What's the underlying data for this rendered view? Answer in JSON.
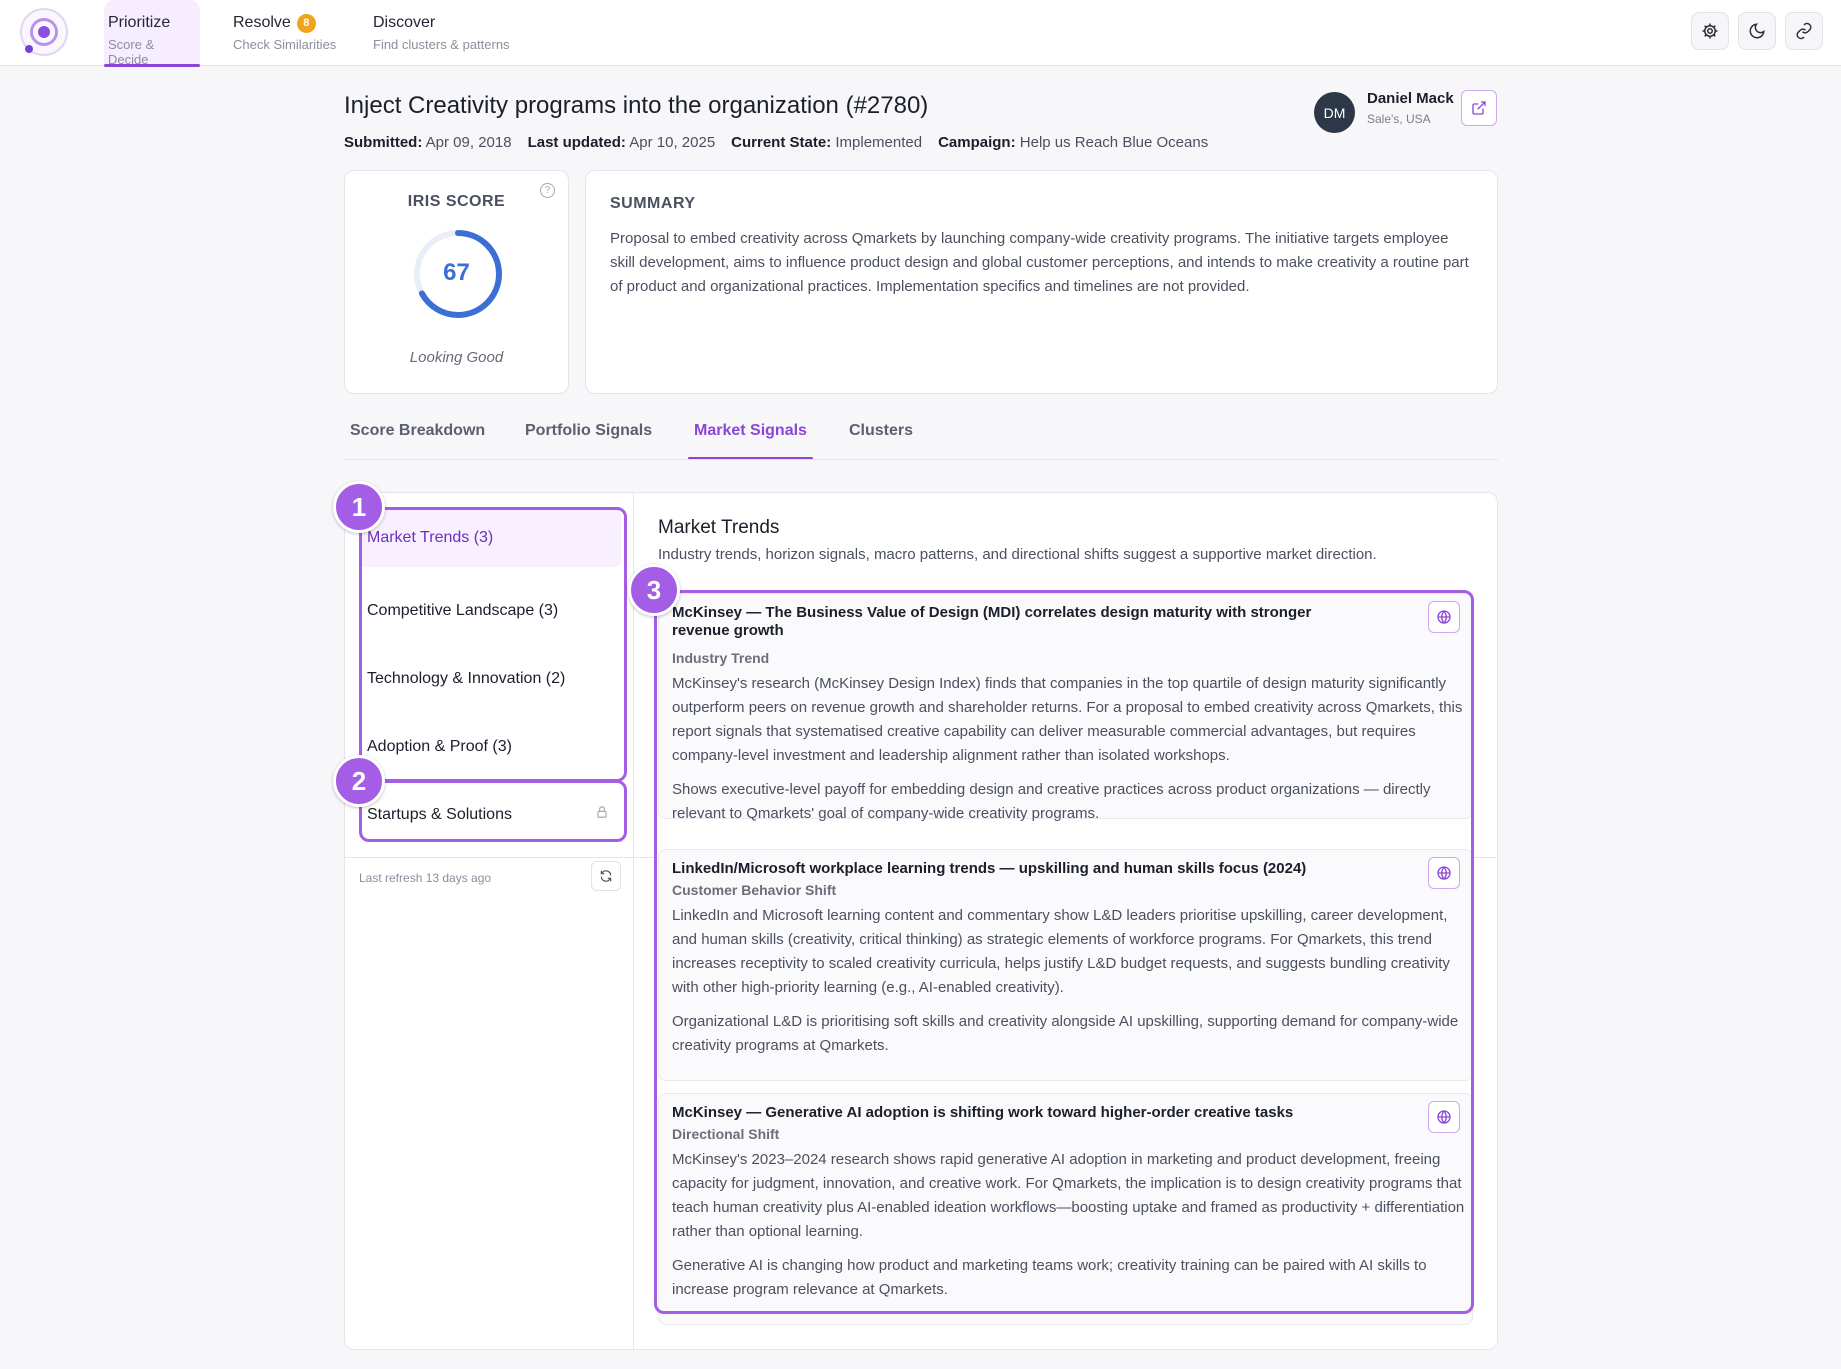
{
  "nav": {
    "tabs": [
      {
        "title": "Prioritize",
        "subtitle": "Score & Decide",
        "badge": null,
        "active": true
      },
      {
        "title": "Resolve",
        "subtitle": "Check Similarities",
        "badge": "8",
        "active": false
      },
      {
        "title": "Discover",
        "subtitle": "Find clusters & patterns",
        "badge": null,
        "active": false
      }
    ],
    "icons": [
      "settings-icon",
      "moon-icon",
      "link-icon"
    ]
  },
  "idea": {
    "title": "Inject Creativity programs into the organization (#2780)",
    "submitted_label": "Submitted:",
    "submitted": "Apr 09, 2018",
    "updated_label": "Last updated:",
    "updated": "Apr 10, 2025",
    "state_label": "Current State:",
    "state": "Implemented",
    "campaign_label": "Campaign:",
    "campaign": "Help us Reach Blue Oceans"
  },
  "author": {
    "initials": "DM",
    "name": "Daniel Mack",
    "location": "Sale's, USA"
  },
  "score": {
    "label": "IRIS SCORE",
    "value": 67,
    "max": 100,
    "status": "Looking Good",
    "color": "#3b6fd6"
  },
  "summary": {
    "heading": "SUMMARY",
    "text": "Proposal to embed creativity across Qmarkets by launching company-wide creativity programs. The initiative targets employee skill development, aims to influence product design and global customer perceptions, and intends to make creativity a routine part of product and organizational practices. Implementation specifics and timelines are not provided."
  },
  "tabs": [
    {
      "label": "Score Breakdown",
      "active": false
    },
    {
      "label": "Portfolio Signals",
      "active": false
    },
    {
      "label": "Market Signals",
      "active": true
    },
    {
      "label": "Clusters",
      "active": false
    }
  ],
  "categories": [
    {
      "label": "Market Trends (3)",
      "active": true,
      "locked": false
    },
    {
      "label": "Competitive Landscape (3)",
      "active": false,
      "locked": false
    },
    {
      "label": "Technology & Innovation (2)",
      "active": false,
      "locked": false
    },
    {
      "label": "Adoption & Proof (3)",
      "active": false,
      "locked": false
    },
    {
      "label": "Startups & Solutions",
      "active": false,
      "locked": true
    }
  ],
  "refresh": {
    "text": "Last refresh 13 days ago"
  },
  "market_trends": {
    "title": "Market Trends",
    "description": "Industry trends, horizon signals, macro patterns, and directional shifts suggest a supportive market direction.",
    "signals": [
      {
        "title": "McKinsey — The Business Value of Design (MDI) correlates design maturity with stronger revenue growth",
        "type": "Industry Trend",
        "body": "McKinsey's research (McKinsey Design Index) finds that companies in the top quartile of design maturity significantly outperform peers on revenue growth and shareholder returns. For a proposal to embed creativity across Qmarkets, this report signals that systematised creative capability can deliver measurable commercial advantages, but requires company-level investment and leadership alignment rather than isolated workshops.",
        "takeaway": "Shows executive-level payoff for embedding design and creative practices across product organizations — directly relevant to Qmarkets' goal of company-wide creativity programs."
      },
      {
        "title": "LinkedIn/Microsoft workplace learning trends — upskilling and human skills focus (2024)",
        "type": "Customer Behavior Shift",
        "body": "LinkedIn and Microsoft learning content and commentary show L&D leaders prioritise upskilling, career development, and human skills (creativity, critical thinking) as strategic elements of workforce programs. For Qmarkets, this trend increases receptivity to scaled creativity curricula, helps justify L&D budget requests, and suggests bundling creativity with other high-priority learning (e.g., AI-enabled creativity).",
        "takeaway": "Organizational L&D is prioritising soft skills and creativity alongside AI upskilling, supporting demand for company-wide creativity programs at Qmarkets."
      },
      {
        "title": "McKinsey — Generative AI adoption is shifting work toward higher-order creative tasks",
        "type": "Directional Shift",
        "body": "McKinsey's 2023–2024 research shows rapid generative AI adoption in marketing and product development, freeing capacity for judgment, innovation, and creative work. For Qmarkets, the implication is to design creativity programs that teach human creativity plus AI-enabled ideation workflows—boosting uptake and framed as productivity + differentiation rather than optional learning.",
        "takeaway": "Generative AI is changing how product and marketing teams work; creativity training can be paired with AI skills to increase program relevance at Qmarkets."
      }
    ]
  },
  "annotations": [
    "1",
    "2",
    "3"
  ],
  "colors": {
    "accent": "#8b46d8",
    "annotation": "#a45ee5",
    "badge": "#f0a41c"
  }
}
